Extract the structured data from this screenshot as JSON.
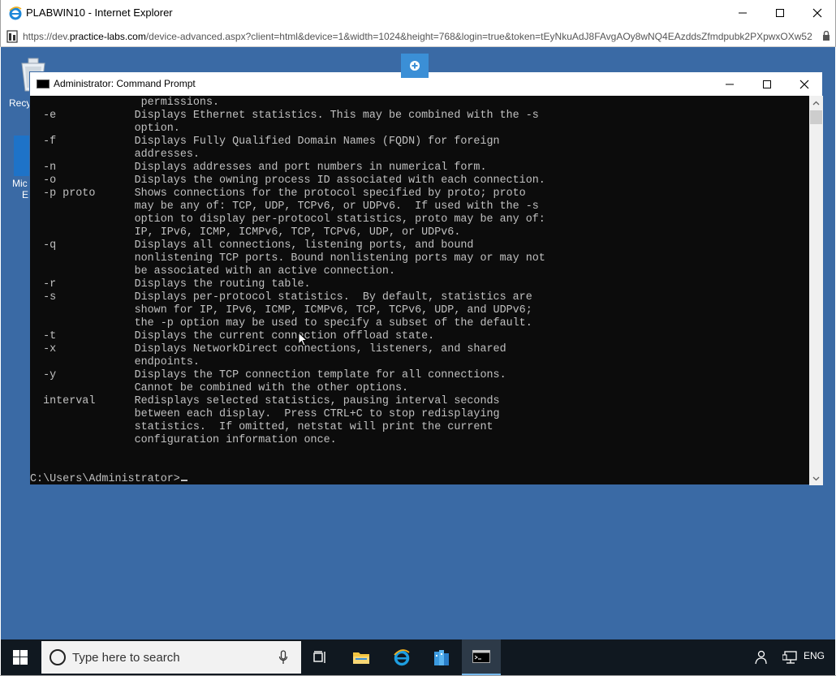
{
  "browser": {
    "title": "PLABWIN10 - Internet Explorer",
    "url_prefix": "https://dev.",
    "url_domain": "practice-labs.com",
    "url_rest": "/device-advanced.aspx?client=html&device=1&width=1024&height=768&login=true&token=tEyNkuAdJ8FAvgAOy8wNQ4EAzddsZfmdpubk2PXpwxOXw52",
    "minimize_icon": "minimize-icon",
    "maximize_icon": "maximize-icon",
    "close_icon": "close-icon"
  },
  "desktop": {
    "icons": [
      {
        "label": "Recy",
        "icon": "recycle-bin-icon"
      },
      {
        "label": "Mic",
        "label2": "E",
        "icon": "edge-icon"
      }
    ]
  },
  "cmd": {
    "title": "Administrator: Command Prompt",
    "lines": [
      "                 permissions.",
      "  -e            Displays Ethernet statistics. This may be combined with the -s",
      "                option.",
      "  -f            Displays Fully Qualified Domain Names (FQDN) for foreign",
      "                addresses.",
      "  -n            Displays addresses and port numbers in numerical form.",
      "  -o            Displays the owning process ID associated with each connection.",
      "  -p proto      Shows connections for the protocol specified by proto; proto",
      "                may be any of: TCP, UDP, TCPv6, or UDPv6.  If used with the -s",
      "                option to display per-protocol statistics, proto may be any of:",
      "                IP, IPv6, ICMP, ICMPv6, TCP, TCPv6, UDP, or UDPv6.",
      "  -q            Displays all connections, listening ports, and bound",
      "                nonlistening TCP ports. Bound nonlistening ports may or may not",
      "                be associated with an active connection.",
      "  -r            Displays the routing table.",
      "  -s            Displays per-protocol statistics.  By default, statistics are",
      "                shown for IP, IPv6, ICMP, ICMPv6, TCP, TCPv6, UDP, and UDPv6;",
      "                the -p option may be used to specify a subset of the default.",
      "  -t            Displays the current connection offload state.",
      "  -x            Displays NetworkDirect connections, listeners, and shared",
      "                endpoints.",
      "  -y            Displays the TCP connection template for all connections.",
      "                Cannot be combined with the other options.",
      "  interval      Redisplays selected statistics, pausing interval seconds",
      "                between each display.  Press CTRL+C to stop redisplaying",
      "                statistics.  If omitted, netstat will print the current",
      "                configuration information once.",
      "",
      "",
      "C:\\Users\\Administrator>"
    ]
  },
  "taskbar": {
    "search_placeholder": "Type here to search",
    "language": "ENG",
    "items": [
      "task-view-icon",
      "file-explorer-icon",
      "internet-explorer-icon",
      "server-manager-icon",
      "command-prompt-icon"
    ]
  }
}
